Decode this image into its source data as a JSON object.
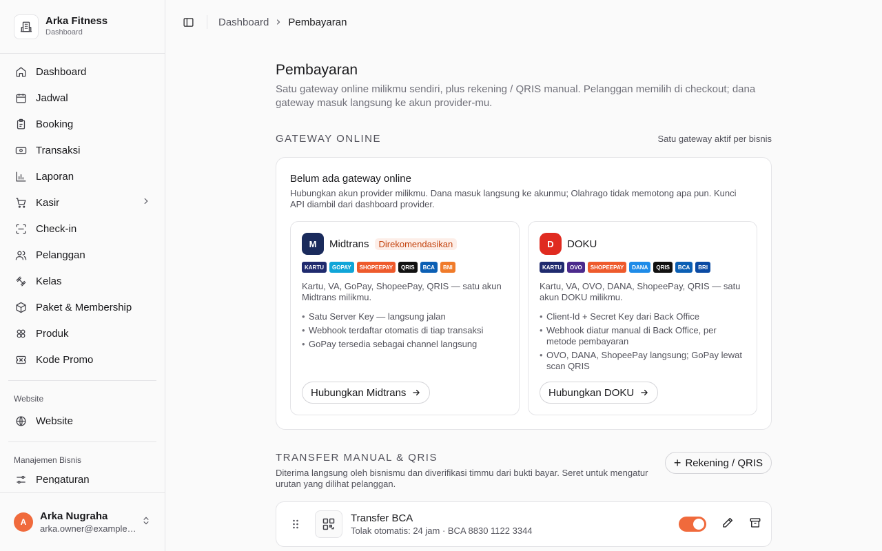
{
  "sidebar": {
    "brand": {
      "name": "Arka Fitness",
      "subtitle": "Dashboard"
    },
    "items": [
      {
        "label": "Dashboard",
        "icon": "home-icon"
      },
      {
        "label": "Jadwal",
        "icon": "calendar-icon"
      },
      {
        "label": "Booking",
        "icon": "clipboard-icon"
      },
      {
        "label": "Transaksi",
        "icon": "banknote-icon"
      },
      {
        "label": "Laporan",
        "icon": "bar-chart-icon"
      },
      {
        "label": "Kasir",
        "icon": "cart-icon"
      },
      {
        "label": "Check-in",
        "icon": "scan-icon"
      },
      {
        "label": "Pelanggan",
        "icon": "users-icon"
      },
      {
        "label": "Kelas",
        "icon": "dumbbell-icon"
      },
      {
        "label": "Paket & Membership",
        "icon": "package-icon"
      },
      {
        "label": "Produk",
        "icon": "products-icon"
      },
      {
        "label": "Kode Promo",
        "icon": "ticket-icon"
      }
    ],
    "group_website": {
      "label": "Website",
      "item": "Website"
    },
    "group_business": {
      "label": "Manajemen Bisnis",
      "item": "Pengaturan"
    },
    "user": {
      "initial": "A",
      "name": "Arka Nugraha",
      "email": "arka.owner@example.com"
    }
  },
  "breadcrumb": {
    "parent": "Dashboard",
    "current": "Pembayaran"
  },
  "page": {
    "title": "Pembayaran",
    "description": "Satu gateway online milikmu sendiri, plus rekening / QRIS manual. Pelanggan memilih di checkout; dana gateway masuk langsung ke akun provider-mu."
  },
  "gateway": {
    "section_title": "Gateway Online",
    "note": "Satu gateway aktif per bisnis",
    "empty_title": "Belum ada gateway online",
    "empty_desc": "Hubungkan akun provider milikmu. Dana masuk langsung ke akunmu; Olahrago tidak memotong apa pun. Kunci API diambil dari dashboard provider.",
    "providers": [
      {
        "logo": "M",
        "name": "Midtrans",
        "badge": "Direkomendasikan",
        "chips": [
          "KARTU",
          "GOPAY",
          "SHOPEEPAY",
          "QRIS",
          "BCA",
          "BNI"
        ],
        "desc": "Kartu, VA, GoPay, ShopeePay, QRIS — satu akun Midtrans milikmu.",
        "bullets": [
          "Satu Server Key — langsung jalan",
          "Webhook terdaftar otomatis di tiap transaksi",
          "GoPay tersedia sebagai channel langsung"
        ],
        "button": "Hubungkan Midtrans"
      },
      {
        "logo": "D",
        "name": "DOKU",
        "badge": "",
        "chips": [
          "KARTU",
          "OVO",
          "SHOPEEPAY",
          "DANA",
          "QRIS",
          "BCA",
          "BRI"
        ],
        "desc": "Kartu, VA, OVO, DANA, ShopeePay, QRIS — satu akun DOKU milikmu.",
        "bullets": [
          "Client-Id + Secret Key dari Back Office",
          "Webhook diatur manual di Back Office, per metode pembayaran",
          "OVO, DANA, ShopeePay langsung; GoPay lewat scan QRIS"
        ],
        "button": "Hubungkan DOKU"
      }
    ]
  },
  "manual": {
    "section_title": "Transfer Manual & QRIS",
    "desc": "Diterima langsung oleh bisnismu dan diverifikasi timmu dari bukti bayar. Seret untuk mengatur urutan yang dilihat pelanggan.",
    "add_label": "Rekening / QRIS",
    "rows": [
      {
        "title": "Transfer BCA",
        "subtitle": "Tolak otomatis: 24 jam · BCA 8830 1122 3344",
        "enabled": true
      }
    ]
  },
  "colors": {
    "accent": "#f06a3c",
    "midtrans": "#1a2b5c",
    "doku": "#e02b20"
  }
}
